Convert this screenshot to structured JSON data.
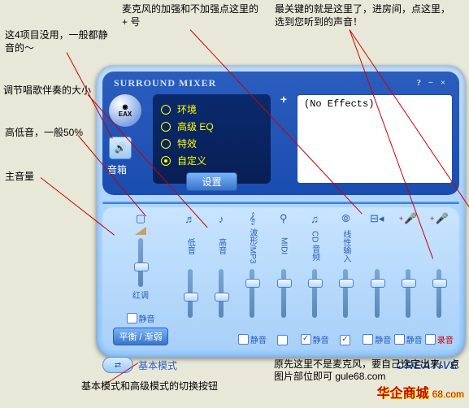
{
  "annotations": {
    "a1": "这4项目没用，一般都静音的～",
    "a2": "调节唱歌伴奏的大小",
    "a3": "高低音，一般50%",
    "a4": "主音量",
    "a5": "麦克风的加强和不加强点这里的 + 号",
    "a6": "最关键的就是这里了，进房间，点这里，选到您听到的声音！",
    "a7": "基本模式和高级模式的切换按钮",
    "a8": "原先这里不是麦克风，要自己选定出来。点图片部位即可 gule68.com"
  },
  "window": {
    "title": "SURROUND MIXER",
    "win_btns": "?  −  ×",
    "eax": "EAX",
    "speaker_label": "音箱",
    "env": {
      "r1": "环境",
      "r2": "高级 EQ",
      "r3": "特效",
      "r4": "自定义",
      "btn": "设置"
    },
    "fx": "(No Effects)",
    "plus": "+"
  },
  "channels": [
    {
      "icon": "▢",
      "label": "红调",
      "type": "wide",
      "thumb": 50,
      "mute": "静音",
      "btn": "平衡 / 渐弱"
    },
    {
      "icon": "♬",
      "label": "低音",
      "thumb": 48,
      "mute": ""
    },
    {
      "icon": "♪",
      "label": "高音",
      "thumb": 48,
      "mute": ""
    },
    {
      "icon": "𝄞",
      "label": "波形/MP3",
      "thumb": 20,
      "mute": "静音",
      "chk": false
    },
    {
      "icon": "⚲",
      "label": "MIDI",
      "thumb": 20,
      "mute": "",
      "chk": false
    },
    {
      "icon": "♫",
      "label": "CD 音频",
      "thumb": 20,
      "mute": "静音",
      "chk": true
    },
    {
      "icon": "⦾",
      "label": "线性输入",
      "thumb": 20,
      "mute": "",
      "chk": true
    },
    {
      "icon": "⊟◂",
      "label": "",
      "thumb": 20,
      "mute": "静音",
      "chk": false
    },
    {
      "icon": "🎤",
      "label": "",
      "thumb": 20,
      "mute": "静音",
      "chk": false,
      "plus": true
    },
    {
      "icon": "🎤",
      "label": "",
      "thumb": 20,
      "mute": "录音",
      "chk": false,
      "rec": true,
      "plus": true
    }
  ],
  "bottom": {
    "mode": "⇄",
    "mode_label": "基本模式",
    "brand": "CREATIVE"
  },
  "watermark": {
    "name": "华企商城",
    "url": "68.com"
  }
}
